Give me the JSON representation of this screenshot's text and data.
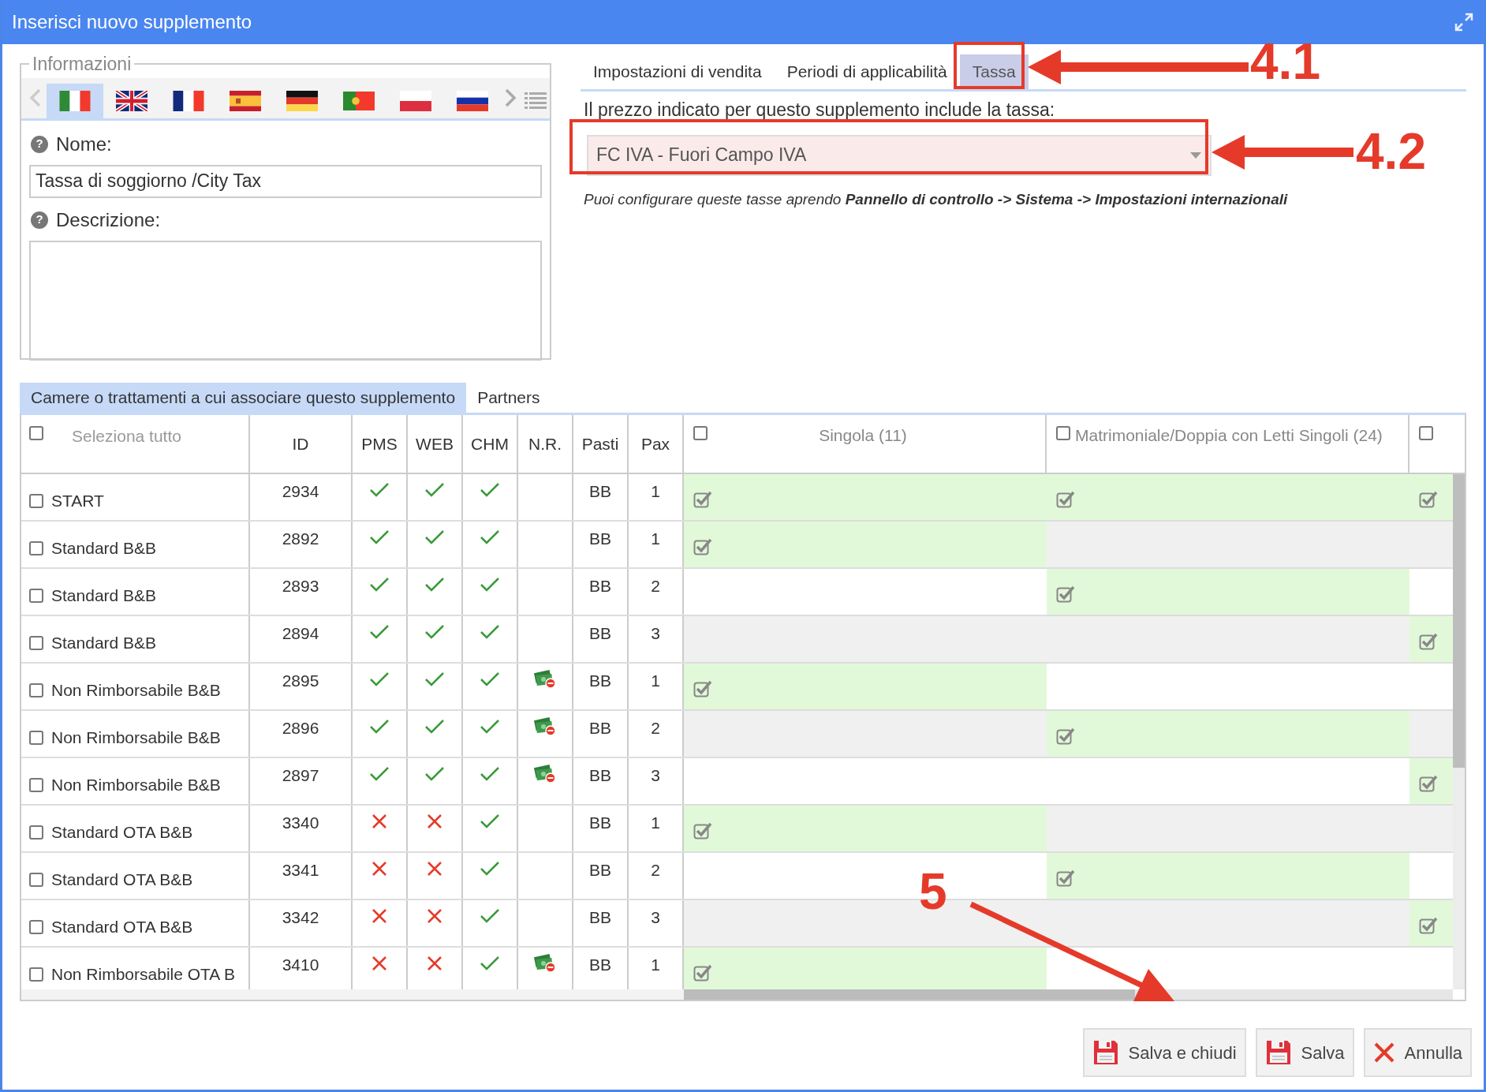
{
  "window": {
    "title": "Inserisci nuovo supplemento"
  },
  "info": {
    "legend": "Informazioni",
    "languages": [
      {
        "kind": "it",
        "selected": true
      },
      {
        "kind": "gb",
        "selected": false
      },
      {
        "kind": "fr",
        "selected": false
      },
      {
        "kind": "es",
        "selected": false
      },
      {
        "kind": "de",
        "selected": false
      },
      {
        "kind": "pt",
        "selected": false
      },
      {
        "kind": "pl",
        "selected": false
      },
      {
        "kind": "ru",
        "selected": false
      }
    ],
    "name_help": "?",
    "description_help": "?",
    "name_label": "Nome:",
    "name_value": "Tassa di soggiorno /City Tax",
    "description_label": "Descrizione:"
  },
  "tabs": [
    {
      "label": "Impostazioni di vendita",
      "selected": false
    },
    {
      "label": "Periodi di applicabilità",
      "selected": false
    },
    {
      "label": "Tassa",
      "selected": true
    }
  ],
  "tax": {
    "prompt": "Il prezzo indicato per questo supplemento include la tassa:",
    "value": "FC IVA - Fuori Campo IVA",
    "note": "Puoi configurare queste tasse aprendo **Pannello di controllo -> Sistema -> Impostazioni internazionali**"
  },
  "section_tabs": [
    {
      "label": "Camere o trattamenti a cui associare questo supplemento",
      "selected": true
    },
    {
      "label": "Partners",
      "selected": false
    }
  ],
  "table": {
    "select_all": {
      "label": "Seleziona tutto",
      "checked": false
    },
    "columns": [
      "ID",
      "PMS",
      "WEB",
      "CHM",
      "N.R.",
      "Pasti",
      "Pax"
    ],
    "room_columns": [
      {
        "label": "Singola (11)",
        "checked": false
      },
      {
        "label": "Matrimoniale/Doppia con Letti Singoli (24)",
        "checked": false
      },
      {
        "checked": false
      }
    ],
    "rows": [
      {
        "checked": false,
        "name": "START",
        "id": "2934",
        "pms": true,
        "web": true,
        "chm": true,
        "nr": false,
        "pasti": "BB",
        "pax": "1",
        "rooms": [
          true,
          true,
          true
        ]
      },
      {
        "checked": false,
        "name": "Standard B&B",
        "id": "2892",
        "pms": true,
        "web": true,
        "chm": true,
        "nr": false,
        "pasti": "BB",
        "pax": "1",
        "rooms": [
          true,
          false,
          false
        ]
      },
      {
        "checked": false,
        "name": "Standard B&B",
        "id": "2893",
        "pms": true,
        "web": true,
        "chm": true,
        "nr": false,
        "pasti": "BB",
        "pax": "2",
        "rooms": [
          false,
          true,
          false
        ]
      },
      {
        "checked": false,
        "name": "Standard B&B",
        "id": "2894",
        "pms": true,
        "web": true,
        "chm": true,
        "nr": false,
        "pasti": "BB",
        "pax": "3",
        "rooms": [
          false,
          false,
          true
        ]
      },
      {
        "checked": false,
        "name": "Non Rimborsabile B&B",
        "id": "2895",
        "pms": true,
        "web": true,
        "chm": true,
        "nr": true,
        "pasti": "BB",
        "pax": "1",
        "rooms": [
          true,
          false,
          false
        ]
      },
      {
        "checked": false,
        "name": "Non Rimborsabile B&B",
        "id": "2896",
        "pms": true,
        "web": true,
        "chm": true,
        "nr": true,
        "pasti": "BB",
        "pax": "2",
        "rooms": [
          false,
          true,
          false
        ]
      },
      {
        "checked": false,
        "name": "Non Rimborsabile B&B",
        "id": "2897",
        "pms": true,
        "web": true,
        "chm": true,
        "nr": true,
        "pasti": "BB",
        "pax": "3",
        "rooms": [
          false,
          false,
          true
        ]
      },
      {
        "checked": false,
        "name": "Standard OTA B&B",
        "id": "3340",
        "pms": false,
        "web": false,
        "chm": true,
        "nr": false,
        "pasti": "BB",
        "pax": "1",
        "rooms": [
          true,
          false,
          false
        ]
      },
      {
        "checked": false,
        "name": "Standard OTA B&B",
        "id": "3341",
        "pms": false,
        "web": false,
        "chm": true,
        "nr": false,
        "pasti": "BB",
        "pax": "2",
        "rooms": [
          false,
          true,
          false
        ]
      },
      {
        "checked": false,
        "name": "Standard OTA B&B",
        "id": "3342",
        "pms": false,
        "web": false,
        "chm": true,
        "nr": false,
        "pasti": "BB",
        "pax": "3",
        "rooms": [
          false,
          false,
          true
        ]
      },
      {
        "checked": false,
        "name": "Non Rimborsabile OTA B",
        "id": "3410",
        "pms": false,
        "web": false,
        "chm": true,
        "nr": true,
        "pasti": "BB",
        "pax": "1",
        "rooms": [
          true,
          false,
          false
        ]
      }
    ]
  },
  "buttons": [
    {
      "label": "Salva e chiudi",
      "kind": "save"
    },
    {
      "label": "Salva",
      "kind": "save"
    },
    {
      "label": "Annulla",
      "kind": "cancel"
    }
  ],
  "annotations": [
    {
      "label": "4.1"
    },
    {
      "label": "4.2"
    },
    {
      "label": "5"
    }
  ]
}
